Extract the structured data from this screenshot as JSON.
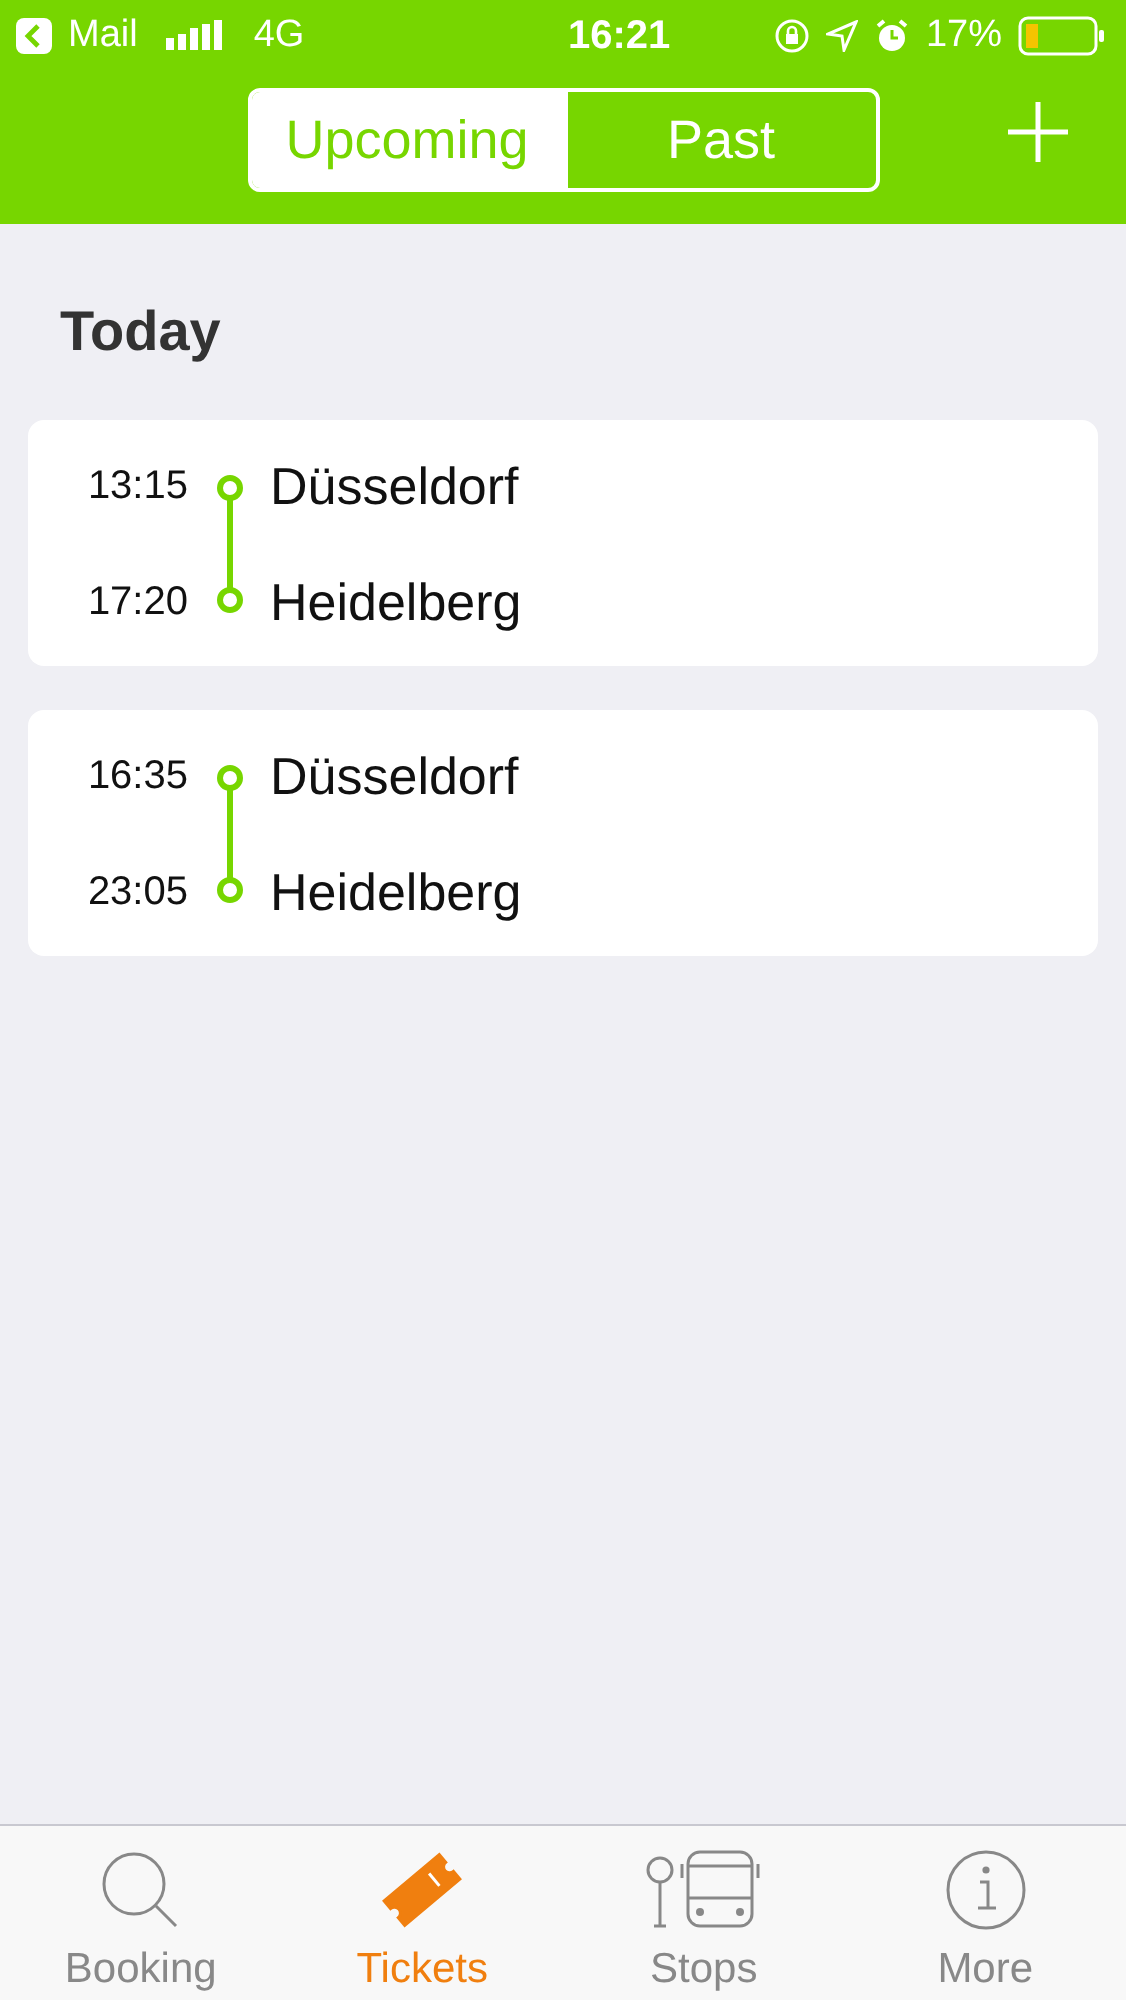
{
  "status_bar": {
    "back_label": "Mail",
    "network": "4G",
    "time": "16:21",
    "battery": "17%"
  },
  "segments": [
    {
      "label": "Upcoming",
      "selected": true
    },
    {
      "label": "Past",
      "selected": false
    }
  ],
  "section_title": "Today",
  "trips": [
    {
      "stops": [
        {
          "time": "13:15",
          "city": "Düsseldorf"
        },
        {
          "time": "17:20",
          "city": "Heidelberg"
        }
      ]
    },
    {
      "stops": [
        {
          "time": "16:35",
          "city": "Düsseldorf"
        },
        {
          "time": "23:05",
          "city": "Heidelberg"
        }
      ]
    }
  ],
  "tab_bar": [
    {
      "label": "Booking",
      "kind": "search",
      "selected": false
    },
    {
      "label": "Tickets",
      "kind": "ticket",
      "selected": true
    },
    {
      "label": "Stops",
      "kind": "stops",
      "selected": false
    },
    {
      "label": "More",
      "kind": "info",
      "selected": false
    }
  ]
}
